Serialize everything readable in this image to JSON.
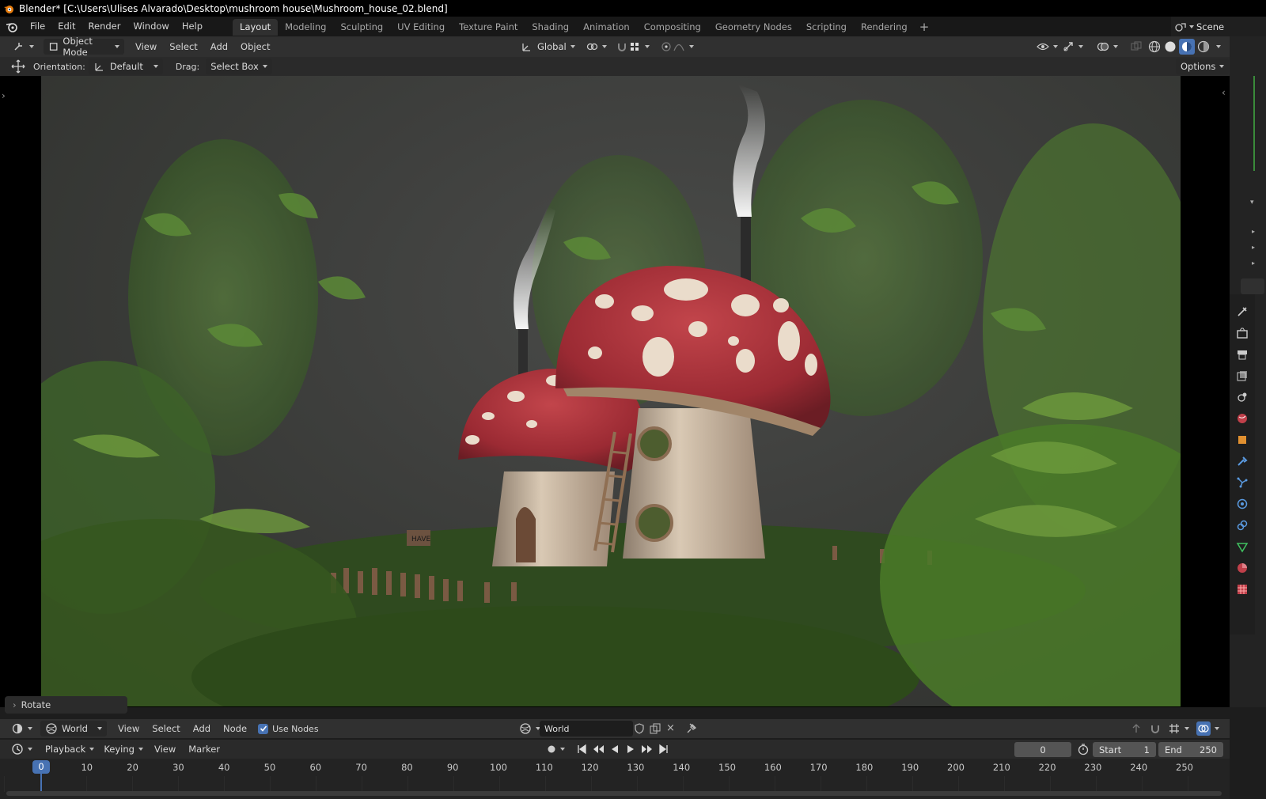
{
  "window": {
    "title": "Blender* [C:\\Users\\Ulises Alvarado\\Desktop\\mushroom house\\Mushroom_house_02.blend]"
  },
  "topbar": {
    "menus": [
      "File",
      "Edit",
      "Render",
      "Window",
      "Help"
    ],
    "workspaces": [
      "Layout",
      "Modeling",
      "Sculpting",
      "UV Editing",
      "Texture Paint",
      "Shading",
      "Animation",
      "Compositing",
      "Geometry Nodes",
      "Scripting",
      "Rendering"
    ],
    "active_workspace": "Layout",
    "add_workspace": "+",
    "scene_label": "Scene"
  },
  "viewport_header": {
    "mode": "Object Mode",
    "menus": [
      "View",
      "Select",
      "Add",
      "Object"
    ],
    "transform_orientation": "Global"
  },
  "tool_settings": {
    "orientation_label": "Orientation:",
    "orientation_value": "Default",
    "drag_label": "Drag:",
    "drag_value": "Select Box",
    "options_label": "Options"
  },
  "viewport": {
    "last_operator": "Rotate",
    "sign_text": "HAVE"
  },
  "shader_header": {
    "shader_type": "World",
    "menus": [
      "View",
      "Select",
      "Add",
      "Node"
    ],
    "use_nodes_label": "Use Nodes",
    "use_nodes_checked": true,
    "world_name": "World"
  },
  "timeline_header": {
    "menus": [
      "Playback",
      "Keying",
      "View",
      "Marker"
    ],
    "current_frame": "0",
    "start_label": "Start",
    "start_value": "1",
    "end_label": "End",
    "end_value": "250"
  },
  "timeline_ruler": {
    "ticks": [
      "10",
      "20",
      "30",
      "40",
      "50",
      "60",
      "70",
      "80",
      "90",
      "100",
      "110",
      "120",
      "130",
      "140",
      "150",
      "160",
      "170",
      "180",
      "190",
      "200",
      "210",
      "220",
      "230",
      "240",
      "250"
    ],
    "cursor_frame": "0"
  },
  "colors": {
    "accent": "#4772b3",
    "mushroom_cap": "#a8303a",
    "foliage": "#3f6b2b"
  }
}
